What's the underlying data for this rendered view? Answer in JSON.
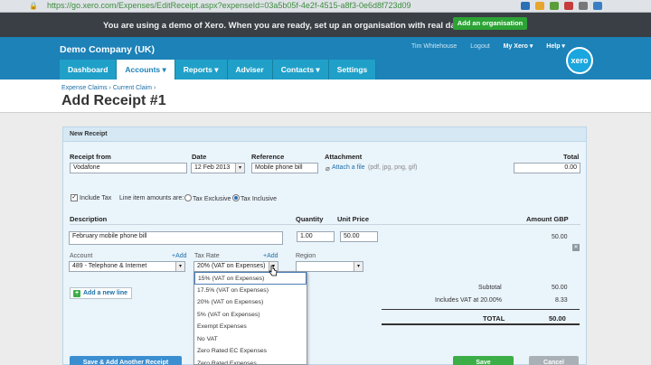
{
  "browser": {
    "url": "https://go.xero.com/Expenses/EditReceipt.aspx?expenseId=03a5b05f-4e2f-4515-a8f3-0e6d8f723d09"
  },
  "banner": {
    "message": "You are using a demo of Xero. When you are ready, set up an organisation with real data.",
    "cta": "Add an organisation"
  },
  "header": {
    "company": "Demo Company (UK)",
    "user": "Tim Whitehouse",
    "logout": "Logout",
    "my_xero": "My Xero ▾",
    "help": "Help ▾",
    "logo": "xero",
    "nav": [
      "Dashboard",
      "Accounts ▾",
      "Reports ▾",
      "Adviser",
      "Contacts ▾",
      "Settings"
    ]
  },
  "breadcrumb": {
    "first": "Expense Claims",
    "sep": "›",
    "second": "Current Claim",
    "sep2": "›"
  },
  "page_title": "Add Receipt #1",
  "form": {
    "panel_title": "New Receipt",
    "receipt_from_label": "Receipt from",
    "receipt_from": "Vodafone",
    "date_label": "Date",
    "date": "12 Feb 2013",
    "reference_label": "Reference",
    "reference": "Mobile phone bill",
    "attachment_label": "Attachment",
    "attach_link": "Attach a file",
    "attach_types": "(pdf, jpg, png, gif)",
    "total_label": "Total",
    "total": "0.00",
    "include_tax": "Include Tax",
    "amounts_are": "Line item amounts are:",
    "tax_exclusive": "Tax Exclusive",
    "tax_inclusive": "Tax Inclusive",
    "col_description": "Description",
    "col_quantity": "Quantity",
    "col_unit_price": "Unit Price",
    "col_amount": "Amount GBP",
    "description": "February mobile phone bill",
    "quantity": "1.00",
    "unit_price": "50.00",
    "amount": "50.00",
    "account_label": "Account",
    "add_link": "+Add",
    "account": "489 - Telephone & Internet",
    "tax_rate_label": "Tax Rate",
    "tax_rate": "20% (VAT on Expenses)",
    "region_label": "Region",
    "region": "",
    "add_new_line": "Add a new line",
    "subtotal_label": "Subtotal",
    "subtotal": "50.00",
    "vat_label": "Includes VAT at 20.00%",
    "vat": "8.33",
    "total_footer_label": "TOTAL",
    "total_footer": "50.00",
    "save_add_another": "Save & Add Another Receipt",
    "save": "Save",
    "cancel": "Cancel"
  },
  "tax_options": [
    "15% (VAT on Expenses)",
    "17.5% (VAT on Expenses)",
    "20% (VAT on Expenses)",
    "5% (VAT on Expenses)",
    "Exempt Expenses",
    "No VAT",
    "Zero Rated EC Expenses",
    "Zero Rated Expenses"
  ],
  "colors": {
    "header": "#1c82b8",
    "banner": "#3a3f46",
    "green": "#3cae48"
  }
}
